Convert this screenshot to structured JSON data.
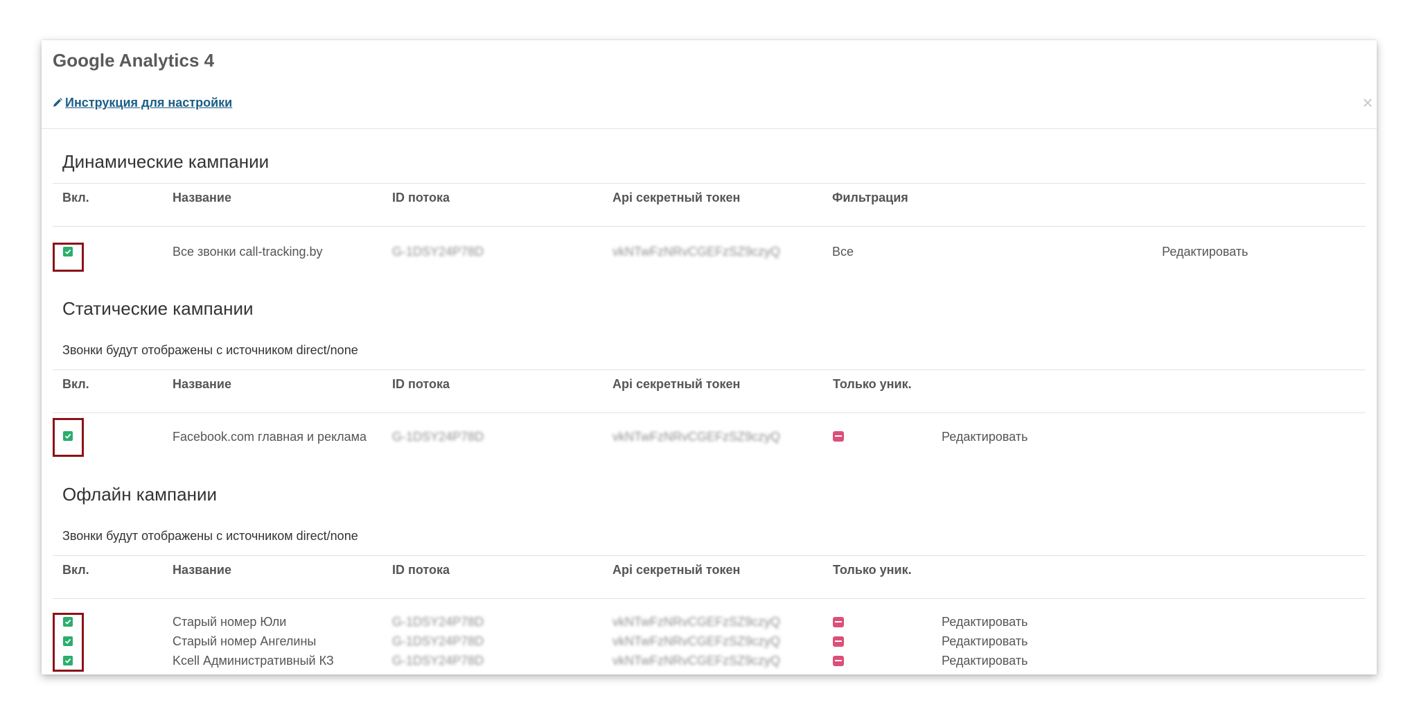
{
  "modal": {
    "title": "Google Analytics 4",
    "instruction_link": "Инструкция для настройки",
    "close_glyph": "×"
  },
  "columns": {
    "enabled": "Вкл.",
    "name": "Название",
    "stream_id": "ID потока",
    "api_secret": "Api секретный токен",
    "filtering": "Фильтрация",
    "unique_only": "Только уник."
  },
  "dynamic": {
    "title": "Динамические кампании",
    "rows": [
      {
        "name": "Все звонки call-tracking.by",
        "stream_id": "G-1DSY24P78D",
        "api_secret": "vkNTwFzNRvCGEFzSZ9czyQ",
        "filter": "Все",
        "edit": "Редактировать"
      }
    ]
  },
  "static": {
    "title": "Статические кампании",
    "note": "Звонки будут отображены с источником direct/none",
    "rows": [
      {
        "name": "Facebook.com главная и реклама",
        "stream_id": "G-1DSY24P78D",
        "api_secret": "vkNTwFzNRvCGEFzSZ9czyQ",
        "edit": "Редактировать"
      }
    ]
  },
  "offline": {
    "title": "Офлайн кампании",
    "note": "Звонки будут отображены с источником direct/none",
    "rows": [
      {
        "name": "Старый номер Юли",
        "stream_id": "G-1DSY24P78D",
        "api_secret": "vkNTwFzNRvCGEFzSZ9czyQ",
        "edit": "Редактировать"
      },
      {
        "name": "Старый номер Ангелины",
        "stream_id": "G-1DSY24P78D",
        "api_secret": "vkNTwFzNRvCGEFzSZ9czyQ",
        "edit": "Редактировать"
      },
      {
        "name": "Kcell Административный КЗ",
        "stream_id": "G-1DSY24P78D",
        "api_secret": "vkNTwFzNRvCGEFzSZ9czyQ",
        "edit": "Редактировать"
      }
    ]
  },
  "colors": {
    "checkbox_on": "#2cae6c",
    "unique_off": "#dc4f78",
    "highlight": "#8b1217",
    "link": "#1a5e87"
  },
  "icons": {
    "instruction": "pencil-icon",
    "checked": "check-icon",
    "unique": "minus-icon"
  }
}
